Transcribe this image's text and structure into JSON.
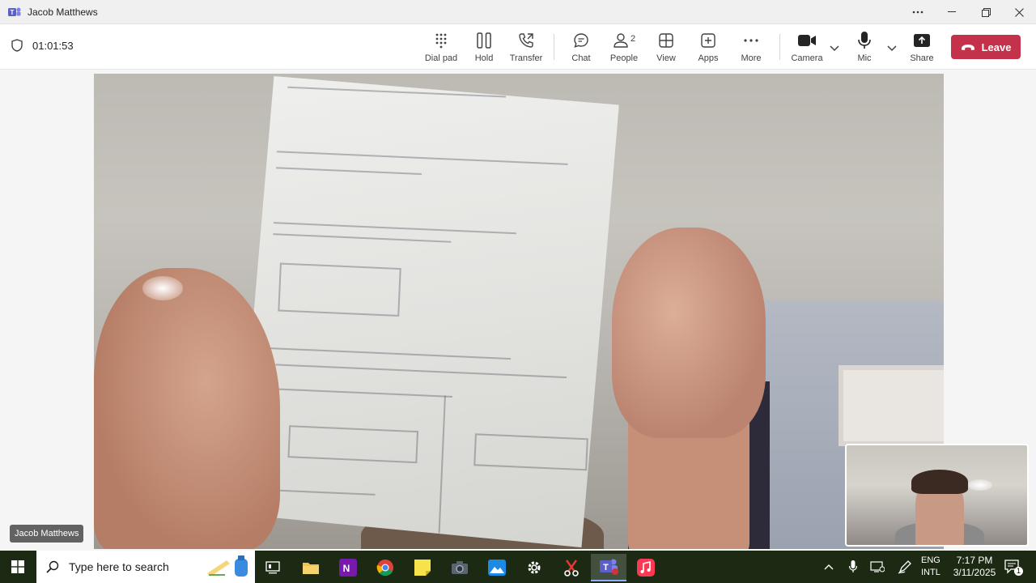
{
  "window": {
    "title": "Jacob Matthews",
    "more_icon": "ellipsis-icon"
  },
  "toolbar": {
    "timer": "01:01:53",
    "buttons": {
      "dialpad": "Dial pad",
      "hold": "Hold",
      "transfer": "Transfer",
      "chat": "Chat",
      "people": "People",
      "people_count": "2",
      "view": "View",
      "apps": "Apps",
      "more": "More",
      "camera": "Camera",
      "mic": "Mic",
      "share": "Share"
    },
    "leave": "Leave",
    "leave_color": "#c4314b"
  },
  "stage": {
    "participant_name": "Jacob Matthews"
  },
  "taskbar": {
    "search_placeholder": "Type here to search",
    "lang_line1": "ENG",
    "lang_line2": "INTL",
    "time": "7:17 PM",
    "date": "3/11/2025",
    "notification_count": "1"
  }
}
